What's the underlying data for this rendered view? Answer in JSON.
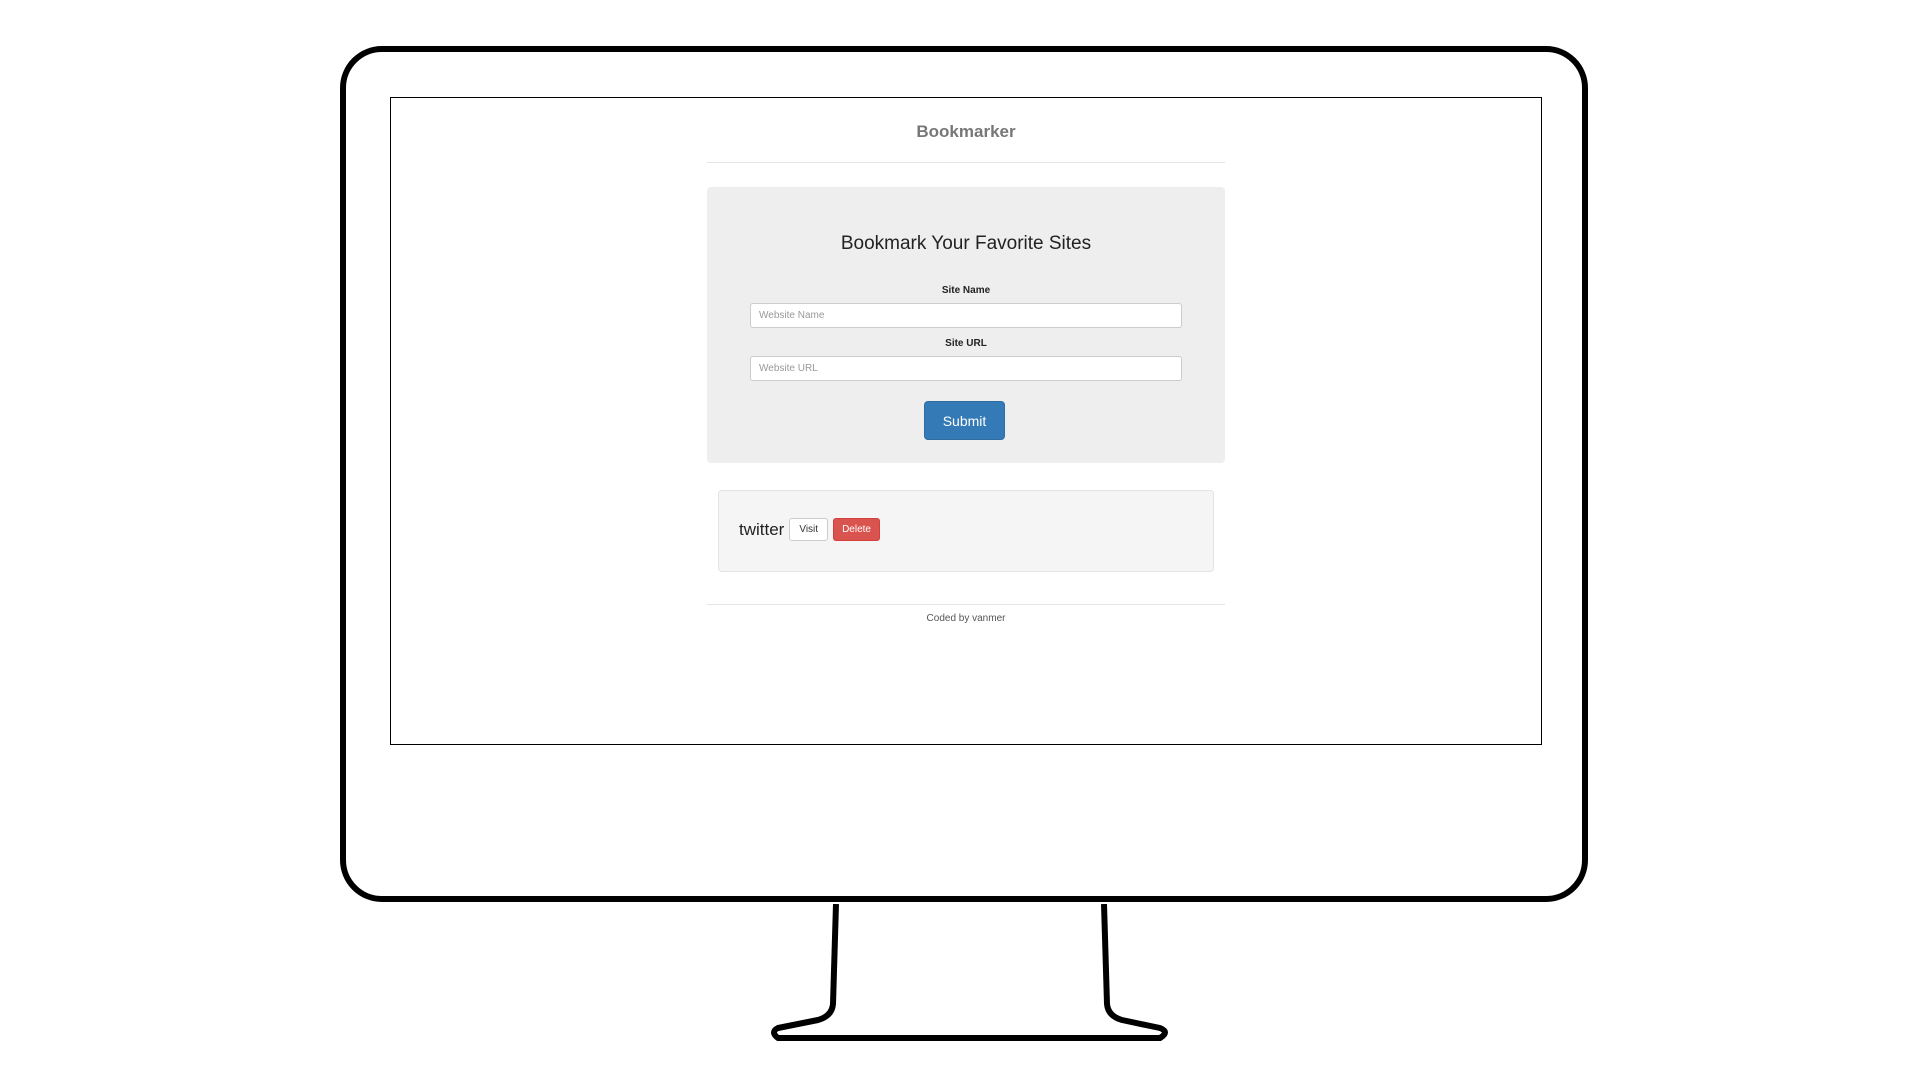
{
  "header": {
    "title": "Bookmarker"
  },
  "form": {
    "heading": "Bookmark Your Favorite Sites",
    "site_name_label": "Site Name",
    "site_name_placeholder": "Website Name",
    "site_name_value": "",
    "site_url_label": "Site URL",
    "site_url_placeholder": "Website URL",
    "site_url_value": "",
    "submit_label": "Submit"
  },
  "bookmarks": [
    {
      "name": "twitter",
      "visit_label": "Visit",
      "delete_label": "Delete"
    }
  ],
  "footer": {
    "text": "Coded by vanmer"
  },
  "colors": {
    "primary": "#337ab7",
    "danger": "#d9534f",
    "jumbotron_bg": "#eeeeee",
    "panel_bg": "#f5f5f5"
  },
  "icons": [
    "monitor-illustration"
  ]
}
